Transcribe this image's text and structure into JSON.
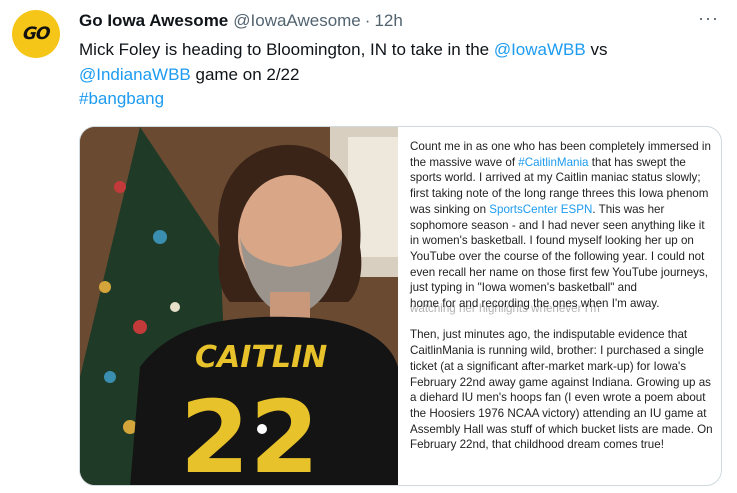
{
  "author": {
    "name": "Go Iowa Awesome",
    "handle": "@IowaAwesome",
    "separator": "·",
    "time": "12h",
    "avatar_text": "GO"
  },
  "more_label": "···",
  "tweet": {
    "text_1": "Mick Foley is heading to Bloomington, IN to take in the ",
    "mention_1": "@IowaWBB",
    "text_2": " vs ",
    "mention_2": "@IndianaWBB",
    "text_3": " game on 2/22",
    "hashtag": "#bangbang"
  },
  "photo": {
    "shirt_text": "CAITLIN",
    "shirt_number": "22"
  },
  "letter": {
    "p1_a": "Count me in as one who has been completely immersed in the massive wave of ",
    "p1_tag": "#CaitlinMania",
    "p1_b": " that has swept the sports world.  I arrived at my Caitlin maniac status slowly; first taking note of the long range threes this Iowa phenom was sinking on ",
    "p1_link": "SportsCenter ESPN",
    "p1_c": ".  This was her sophomore season - and I had never seen anything like it in women's basketball.  I found myself looking her up on YouTube over the course of the following year.  I could not even recall her name on those first few YouTube journeys, just typing in \"Iowa women's basketball\" and",
    "p1_d": "home for and recording the ones when I'm away.",
    "overlap": "watching her highlights whenever I'm",
    "p2": "Then, just minutes ago, the indisputable evidence that CaitlinMania is running wild, brother: I purchased a single ticket (at a significant after-market mark-up) for Iowa's February 22nd away game against Indiana. Growing up as a diehard IU men's hoops fan (I even wrote a poem about the Hoosiers 1976 NCAA victory) attending an IU game at Assembly Hall was stuff of which bucket lists are made.  On February 22nd, that childhood dream comes true!"
  }
}
